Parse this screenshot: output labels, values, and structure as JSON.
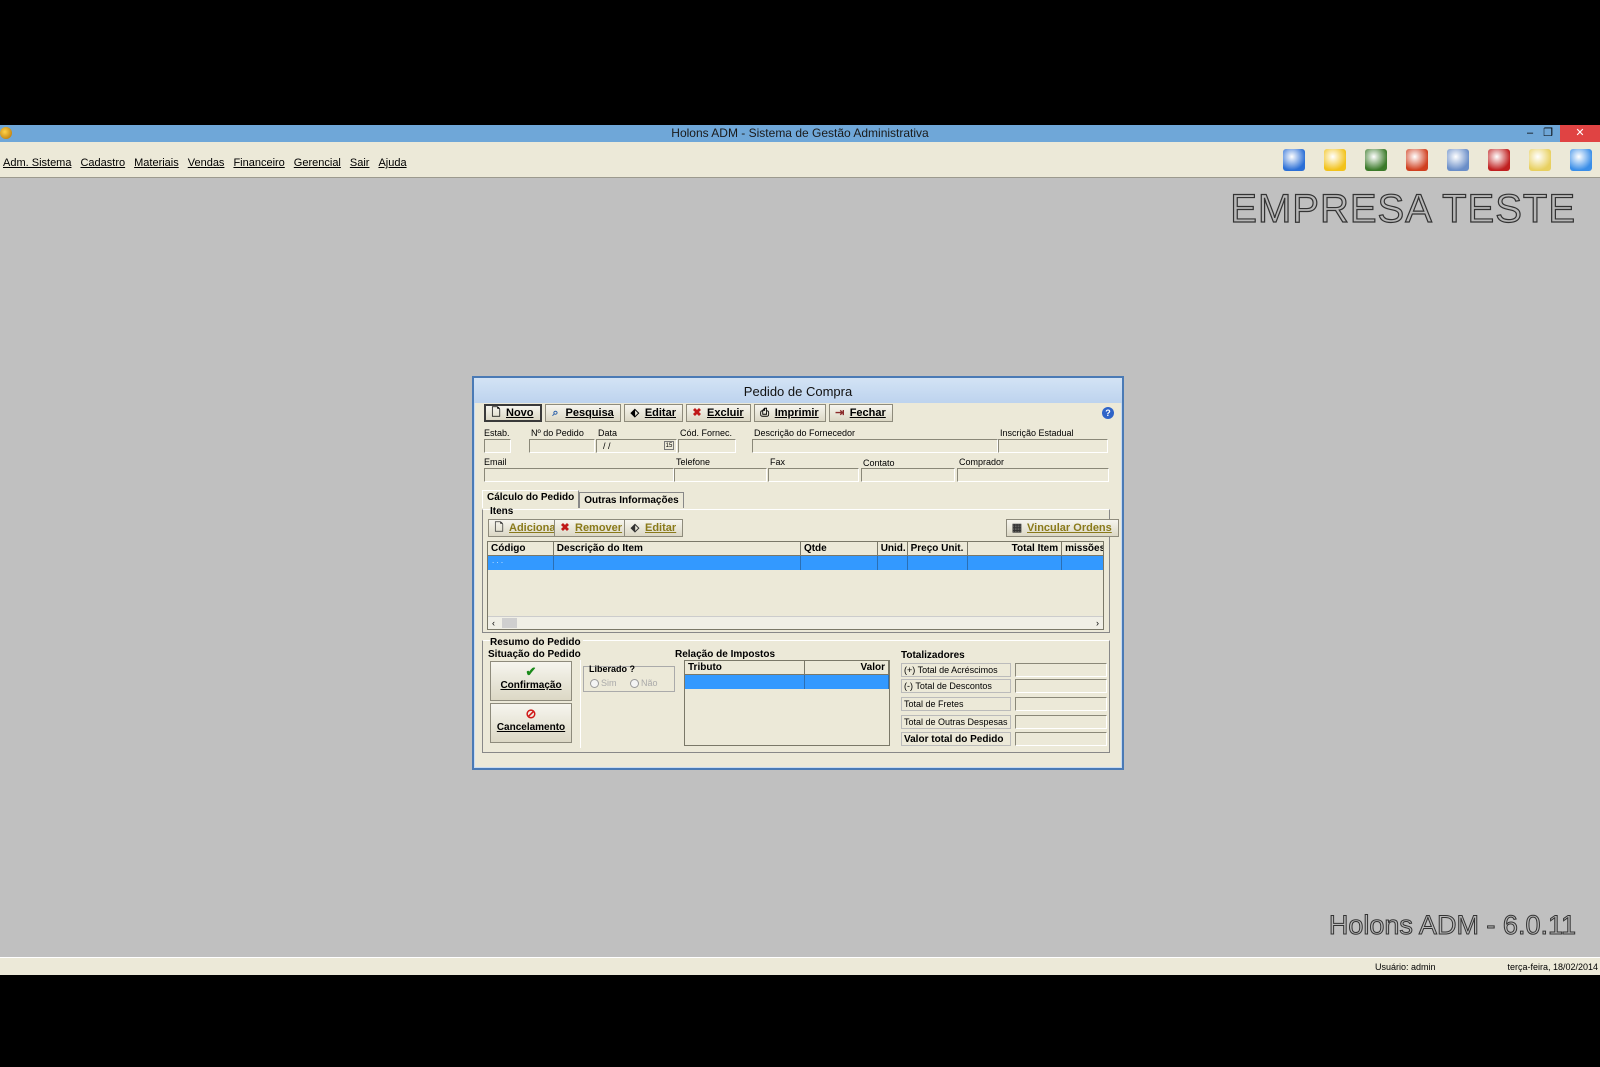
{
  "window": {
    "title": "Holons ADM - Sistema de Gestão Administrativa",
    "minimize": "–",
    "restore": "❐",
    "close": "✕"
  },
  "menu": {
    "items": [
      "Adm. Sistema",
      "Cadastro",
      "Materiais",
      "Vendas",
      "Financeiro",
      "Gerencial",
      "Sair",
      "Ajuda"
    ]
  },
  "toolbar_icons": [
    {
      "name": "user-icon",
      "color": "#2b6fd6"
    },
    {
      "name": "star-icon",
      "color": "#f2c21a"
    },
    {
      "name": "globe-icon",
      "color": "#3b7a2a"
    },
    {
      "name": "notepad-icon",
      "color": "#d04020"
    },
    {
      "name": "documents-icon",
      "color": "#6a8ec8"
    },
    {
      "name": "calendar-icon",
      "color": "#c02020"
    },
    {
      "name": "xml-icon",
      "color": "#e8d060"
    },
    {
      "name": "windows-icon",
      "color": "#3a8ee8"
    }
  ],
  "brand": "EMPRESA TESTE",
  "version": "Holons ADM - 6.0.11",
  "status": {
    "user": "Usuário: admin",
    "date": "terça-feira, 18/02/2014"
  },
  "dialog": {
    "title": "Pedido de Compra",
    "buttons": {
      "novo": "Novo",
      "pesquisa": "Pesquisa",
      "editar": "Editar",
      "excluir": "Excluir",
      "imprimir": "Imprimir",
      "fechar": "Fechar"
    },
    "help": "?",
    "fields": {
      "estab": "Estab.",
      "nr_pedido": "Nº do Pedido",
      "data": "Data",
      "data_value": "/ /",
      "cod_fornec": "Cód. Fornec.",
      "desc_fornecedor": "Descrição do Fornecedor",
      "inscricao": "Inscrição Estadual",
      "email": "Email",
      "telefone": "Telefone",
      "fax": "Fax",
      "contato": "Contato",
      "comprador": "Comprador"
    },
    "tabs": [
      "Cálculo do Pedido",
      "Outras Informações"
    ],
    "itens": {
      "label": "Itens",
      "adicionar": "Adicionar",
      "remover": "Remover",
      "editar": "Editar",
      "vincular": "Vincular Ordens",
      "columns": [
        "Código",
        "Descrição do Item",
        "Qtde",
        "Unid.",
        "Preço Unit.",
        "Total Item",
        "missões"
      ],
      "row_code": ". . ."
    },
    "resumo": {
      "label": "Resumo do Pedido",
      "situacao": "Situação do Pedido",
      "confirmacao": "Confirmação",
      "cancelamento": "Cancelamento",
      "liberado": "Liberado ?",
      "sim": "Sim",
      "nao": "Não",
      "impostos": "Relação de Impostos",
      "tributo": "Tributo",
      "valor": "Valor",
      "totalizadores": "Totalizadores",
      "totals": [
        "(+) Total de Acréscimos",
        "(-) Total de Descontos",
        "Total de Fretes",
        "Total de Outras Despesas",
        "Valor total do Pedido"
      ]
    }
  }
}
